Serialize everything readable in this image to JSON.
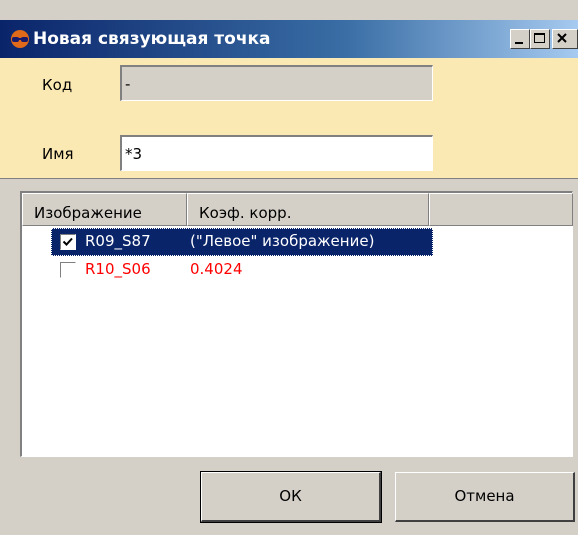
{
  "window": {
    "title": "Новая связующая точка",
    "icon": "glasses-icon",
    "controls": [
      "minimize-icon",
      "maximize-icon",
      "close-icon"
    ]
  },
  "form": {
    "code_label": "Код",
    "code_value": "-",
    "name_label": "Имя",
    "name_value": "*3"
  },
  "list": {
    "columns": [
      "Изображение",
      "Коэф. корр."
    ],
    "rows": [
      {
        "checked": true,
        "image": "R09_S87",
        "coef": "(\"Левое\" изображение)",
        "selected": true,
        "color": "#ffffff"
      },
      {
        "checked": false,
        "image": "R10_S06",
        "coef": "0.4024",
        "selected": false,
        "color": "#ff0000"
      }
    ]
  },
  "buttons": {
    "ok": "ОК",
    "cancel": "Отмена"
  },
  "colors": {
    "title_gradient_start": "#0a246a",
    "title_gradient_end": "#a6caf0",
    "form_background": "#fbe9b3",
    "selection": "#0a246a",
    "error_text": "#ff0000"
  }
}
